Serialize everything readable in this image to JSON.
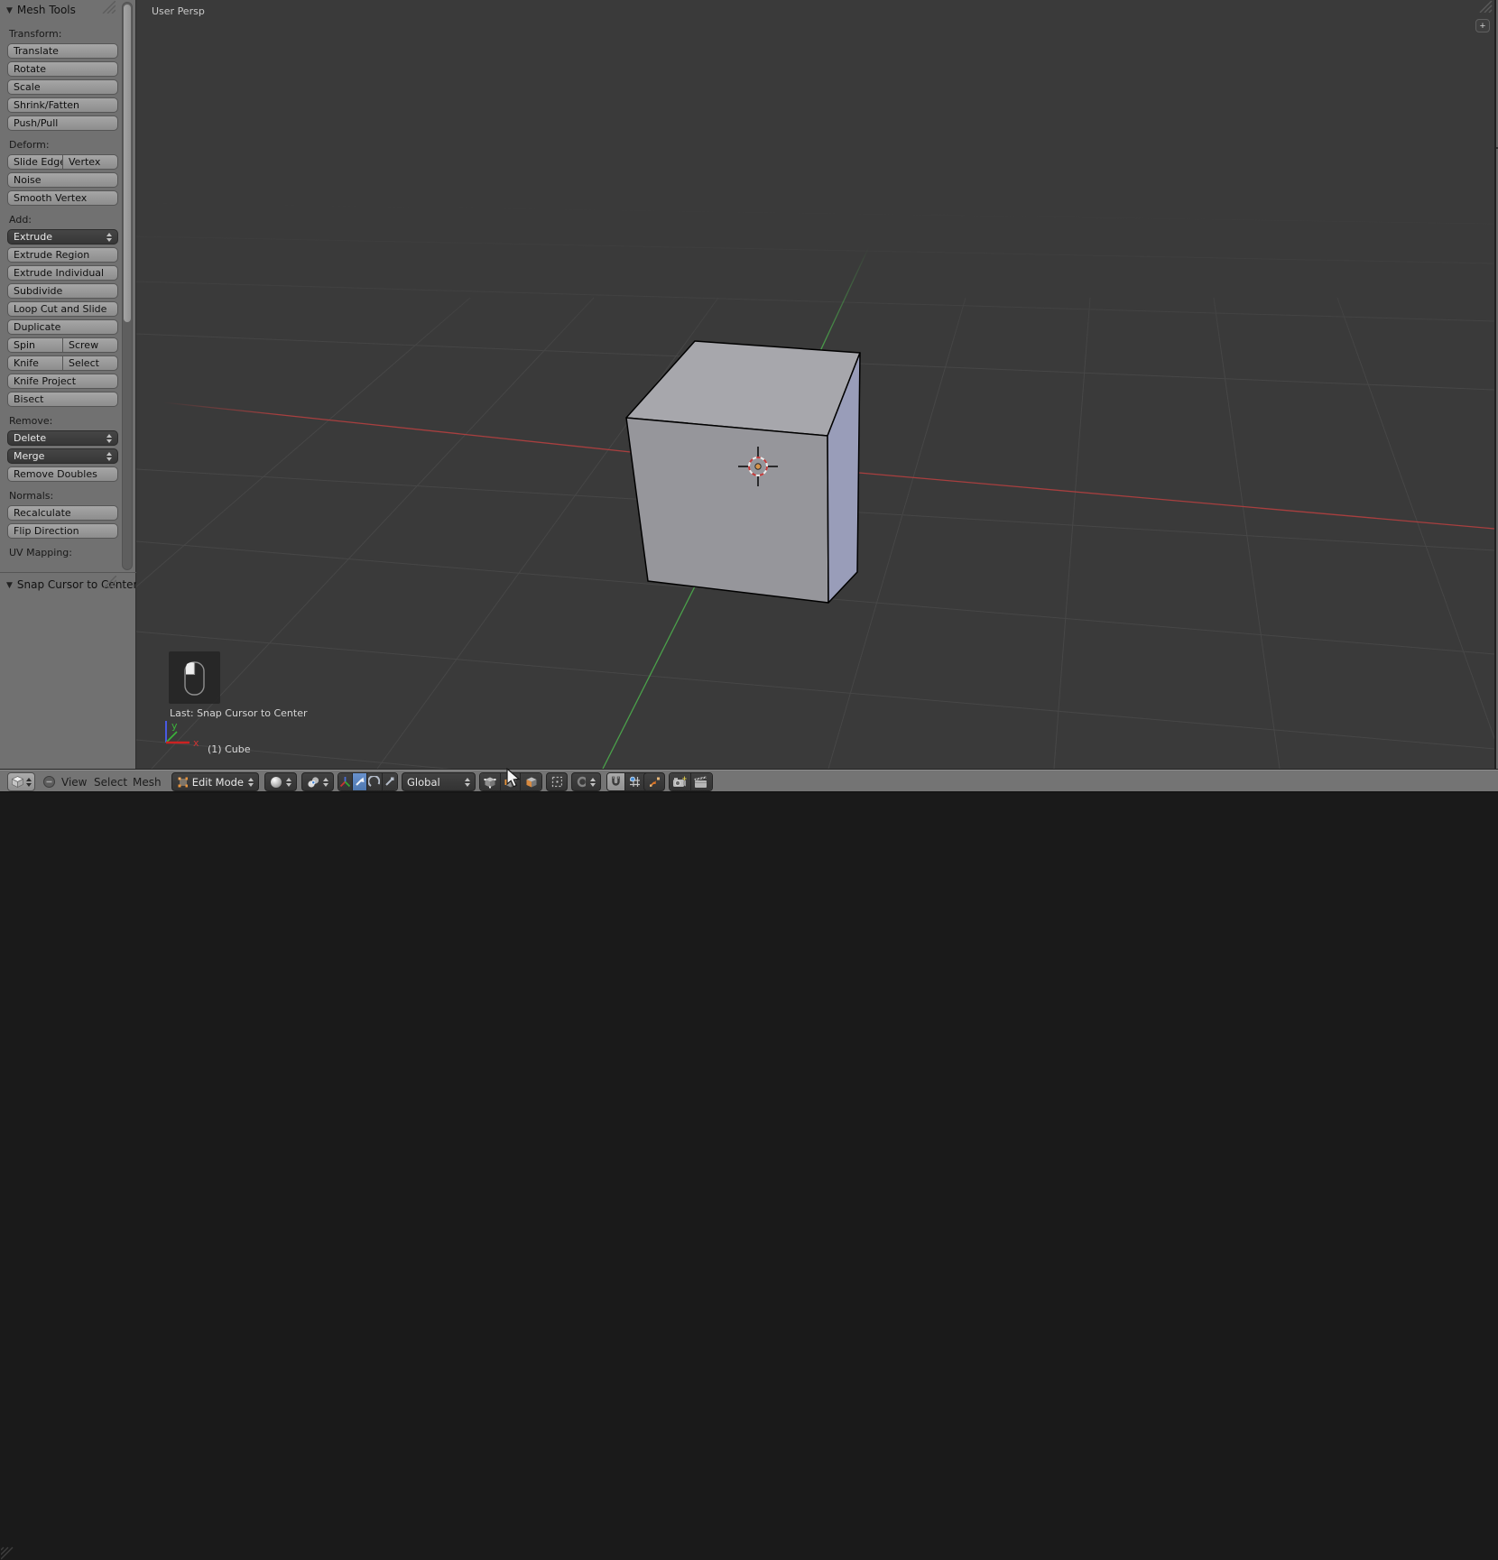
{
  "tool_shelf": {
    "panel_title": "Mesh Tools",
    "bottom_panel_title": "Snap Cursor to Center",
    "sections": [
      {
        "label": "Transform:",
        "buttons": [
          {
            "label": "Translate"
          },
          {
            "label": "Rotate"
          },
          {
            "label": "Scale"
          },
          {
            "label": "Shrink/Fatten"
          },
          {
            "label": "Push/Pull"
          }
        ]
      },
      {
        "label": "Deform:",
        "buttons": [
          {
            "split": [
              "Slide Edge",
              "Vertex"
            ]
          },
          {
            "label": "Noise"
          },
          {
            "label": "Smooth Vertex"
          }
        ]
      },
      {
        "label": "Add:",
        "buttons": [
          {
            "label": "Extrude",
            "type": "menu"
          },
          {
            "label": "Extrude Region"
          },
          {
            "label": "Extrude Individual"
          },
          {
            "label": "Subdivide"
          },
          {
            "label": "Loop Cut and Slide"
          },
          {
            "label": "Duplicate"
          },
          {
            "split": [
              "Spin",
              "Screw"
            ]
          },
          {
            "split": [
              "Knife",
              "Select"
            ]
          },
          {
            "label": "Knife Project"
          },
          {
            "label": "Bisect"
          }
        ]
      },
      {
        "label": "Remove:",
        "buttons": [
          {
            "label": "Delete",
            "type": "menu"
          },
          {
            "label": "Merge",
            "type": "menu"
          },
          {
            "label": "Remove Doubles"
          }
        ]
      },
      {
        "label": "Normals:",
        "buttons": [
          {
            "label": "Recalculate"
          },
          {
            "label": "Flip Direction"
          }
        ]
      },
      {
        "label": "UV Mapping:",
        "buttons": []
      }
    ]
  },
  "viewport": {
    "view_label": "User Persp",
    "last_action": "Last: Snap Cursor to Center",
    "object_info": "(1) Cube",
    "expand_button": "+",
    "axis_gizmo": {
      "x_label": "x",
      "y_label": "y"
    },
    "colors": {
      "background": "#3a3a3a",
      "grid": "#474747",
      "x_axis": "#a83f3f",
      "y_axis": "#4aa04a",
      "cube_top": "#a7a7ac",
      "cube_front": "#96969b",
      "cube_right": "#999db9",
      "cursor_ring_red": "#c23a3a",
      "cursor_center": "#d6954b",
      "selected_accent": "#5b87c5"
    }
  },
  "header": {
    "menus": {
      "view": "View",
      "select": "Select",
      "mesh": "Mesh"
    },
    "mode_label": "Edit Mode",
    "orientation_label": "Global",
    "icons": {
      "editor_type": "3d-view-cube-icon",
      "collapse_menus": "minus-circle-icon",
      "mode": "edit-mode-icon",
      "shading": "sphere-icon",
      "pivot": "median-point-icon",
      "manipulator": "axis-manipulator-icon",
      "translate": "translate-arrow-icon",
      "rotate": "rotate-arc-icon",
      "scale": "scale-arrow-icon",
      "select_vertex": "vertex-cube-icon",
      "select_edge": "edge-cube-icon",
      "select_face": "face-cube-icon",
      "occlude": "limit-selection-icon",
      "proportional": "proportional-circle-icon",
      "snap": "magnet-icon",
      "snap_element": "snap-increment-icon",
      "snap_target": "arrows-inward-icon",
      "opengl_render": "camera-icon",
      "opengl_render_anim": "clapperboard-icon"
    }
  }
}
